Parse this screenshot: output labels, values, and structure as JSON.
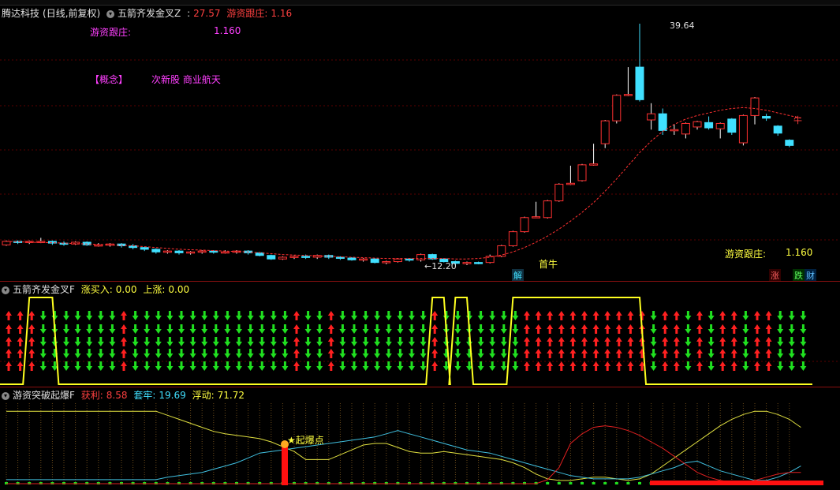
{
  "window": {
    "stock_name": "腾达科技",
    "mode": "(日线,前复权)"
  },
  "main_panel": {
    "indicator_name": "五箭齐发金叉Z",
    "price": "27.57",
    "label_youzi": "游资跟庄:",
    "value_youzi": "1.16",
    "overlay_label": "游资跟庄:",
    "overlay_value": "1.160",
    "concept_label": "【概念】",
    "concept_value": "次新股 商业航天",
    "bottom_label": "游资跟庄:",
    "bottom_value": "1.160",
    "high_label": "39.64",
    "low_label": "←12.20",
    "first_bull": "首牛",
    "tag_unlock": "解",
    "tag_bull": "牛",
    "tag_rise": "涨",
    "tag_fall": "跌",
    "tag_fin": "财",
    "colors": {
      "up": "#ff3030",
      "down": "#40e0ff",
      "ma": "#ff3030"
    }
  },
  "mid_panel": {
    "indicator_name": "五箭齐发金叉F",
    "label_buy": "涨买入:",
    "value_buy": "0.00",
    "label_rise": "上涨:",
    "value_rise": "0.00"
  },
  "bottom_panel": {
    "indicator_name": "游资突破起爆F",
    "label_profit": "获利:",
    "value_profit": "8.58",
    "label_trap": "套牢:",
    "value_trap": "19.69",
    "label_float": "浮动:",
    "value_float": "71.72",
    "explode_label": "★起爆点"
  },
  "chart_data": {
    "type": "candlestick",
    "price_range": [
      12.2,
      39.64
    ],
    "candles": [
      {
        "o": 14.5,
        "c": 14.9,
        "h": 15.0,
        "l": 14.4
      },
      {
        "o": 14.9,
        "c": 14.8,
        "h": 15.0,
        "l": 14.6
      },
      {
        "o": 14.8,
        "c": 14.9,
        "h": 15.0,
        "l": 14.6
      },
      {
        "o": 14.9,
        "c": 14.9,
        "h": 15.3,
        "l": 14.7
      },
      {
        "o": 14.9,
        "c": 14.7,
        "h": 15.0,
        "l": 14.5
      },
      {
        "o": 14.7,
        "c": 14.6,
        "h": 14.9,
        "l": 14.4
      },
      {
        "o": 14.6,
        "c": 14.8,
        "h": 14.9,
        "l": 14.5
      },
      {
        "o": 14.8,
        "c": 14.5,
        "h": 14.9,
        "l": 14.4
      },
      {
        "o": 14.5,
        "c": 14.5,
        "h": 14.7,
        "l": 14.3
      },
      {
        "o": 14.5,
        "c": 14.6,
        "h": 14.7,
        "l": 14.3
      },
      {
        "o": 14.6,
        "c": 14.4,
        "h": 14.7,
        "l": 14.2
      },
      {
        "o": 14.4,
        "c": 14.2,
        "h": 14.6,
        "l": 14.0
      },
      {
        "o": 14.2,
        "c": 14.0,
        "h": 14.3,
        "l": 13.8
      },
      {
        "o": 14.0,
        "c": 13.7,
        "h": 14.1,
        "l": 13.5
      },
      {
        "o": 13.7,
        "c": 13.8,
        "h": 13.9,
        "l": 13.5
      },
      {
        "o": 13.8,
        "c": 13.6,
        "h": 13.9,
        "l": 13.4
      },
      {
        "o": 13.6,
        "c": 13.7,
        "h": 13.8,
        "l": 13.4
      },
      {
        "o": 13.7,
        "c": 13.8,
        "h": 13.9,
        "l": 13.5
      },
      {
        "o": 13.8,
        "c": 13.7,
        "h": 13.9,
        "l": 13.5
      },
      {
        "o": 13.7,
        "c": 13.7,
        "h": 13.9,
        "l": 13.5
      },
      {
        "o": 13.7,
        "c": 13.8,
        "h": 13.9,
        "l": 13.5
      },
      {
        "o": 13.8,
        "c": 13.6,
        "h": 13.9,
        "l": 13.4
      },
      {
        "o": 13.6,
        "c": 13.3,
        "h": 13.7,
        "l": 13.2
      },
      {
        "o": 13.3,
        "c": 12.9,
        "h": 13.4,
        "l": 12.8
      },
      {
        "o": 12.9,
        "c": 13.1,
        "h": 13.2,
        "l": 12.8
      },
      {
        "o": 13.1,
        "c": 13.2,
        "h": 13.3,
        "l": 12.9
      },
      {
        "o": 13.2,
        "c": 13.1,
        "h": 13.4,
        "l": 12.9
      },
      {
        "o": 13.1,
        "c": 13.3,
        "h": 13.4,
        "l": 12.9
      },
      {
        "o": 13.3,
        "c": 13.1,
        "h": 13.4,
        "l": 12.9
      },
      {
        "o": 13.1,
        "c": 13.0,
        "h": 13.2,
        "l": 12.8
      },
      {
        "o": 13.0,
        "c": 12.8,
        "h": 13.1,
        "l": 12.7
      },
      {
        "o": 12.8,
        "c": 12.9,
        "h": 13.0,
        "l": 12.6
      },
      {
        "o": 12.9,
        "c": 12.5,
        "h": 13.0,
        "l": 12.4
      },
      {
        "o": 12.5,
        "c": 12.6,
        "h": 12.7,
        "l": 12.3
      },
      {
        "o": 12.6,
        "c": 12.9,
        "h": 13.0,
        "l": 12.5
      },
      {
        "o": 12.9,
        "c": 12.8,
        "h": 13.0,
        "l": 12.6
      },
      {
        "o": 12.8,
        "c": 13.4,
        "h": 13.5,
        "l": 12.6
      },
      {
        "o": 13.4,
        "c": 12.9,
        "h": 13.5,
        "l": 12.8
      },
      {
        "o": 12.9,
        "c": 12.6,
        "h": 13.0,
        "l": 12.5
      },
      {
        "o": 12.6,
        "c": 12.4,
        "h": 12.7,
        "l": 12.2
      },
      {
        "o": 12.4,
        "c": 12.5,
        "h": 12.6,
        "l": 12.2
      },
      {
        "o": 12.5,
        "c": 12.4,
        "h": 12.6,
        "l": 12.3
      },
      {
        "o": 12.5,
        "c": 13.2,
        "h": 13.4,
        "l": 12.4
      },
      {
        "o": 13.2,
        "c": 14.4,
        "h": 14.5,
        "l": 13.1
      },
      {
        "o": 14.4,
        "c": 16.0,
        "h": 16.1,
        "l": 14.3
      },
      {
        "o": 16.0,
        "c": 17.6,
        "h": 17.7,
        "l": 15.9
      },
      {
        "o": 17.6,
        "c": 17.7,
        "h": 19.4,
        "l": 17.6
      },
      {
        "o": 17.6,
        "c": 19.5,
        "h": 19.6,
        "l": 17.5
      },
      {
        "o": 19.5,
        "c": 21.4,
        "h": 21.5,
        "l": 19.4
      },
      {
        "o": 21.4,
        "c": 21.5,
        "h": 23.5,
        "l": 21.3
      },
      {
        "o": 21.8,
        "c": 23.6,
        "h": 23.7,
        "l": 21.7
      },
      {
        "o": 23.6,
        "c": 23.7,
        "h": 26.0,
        "l": 23.5
      },
      {
        "o": 26.0,
        "c": 28.6,
        "h": 28.7,
        "l": 25.5
      },
      {
        "o": 28.6,
        "c": 31.5,
        "h": 31.6,
        "l": 28.3
      },
      {
        "o": 31.5,
        "c": 31.6,
        "h": 34.7,
        "l": 31.4
      },
      {
        "o": 34.7,
        "c": 31.0,
        "h": 39.64,
        "l": 30.8
      },
      {
        "o": 28.7,
        "c": 29.4,
        "h": 30.6,
        "l": 27.6
      },
      {
        "o": 29.4,
        "c": 27.5,
        "h": 30.0,
        "l": 27.0
      },
      {
        "o": 27.6,
        "c": 27.6,
        "h": 28.2,
        "l": 27.0
      },
      {
        "o": 27.1,
        "c": 28.3,
        "h": 28.4,
        "l": 26.6
      },
      {
        "o": 27.9,
        "c": 28.5,
        "h": 28.6,
        "l": 27.6
      },
      {
        "o": 28.4,
        "c": 27.8,
        "h": 29.1,
        "l": 27.6
      },
      {
        "o": 27.7,
        "c": 28.3,
        "h": 28.4,
        "l": 26.6
      },
      {
        "o": 28.8,
        "c": 27.3,
        "h": 28.9,
        "l": 27.0
      },
      {
        "o": 26.1,
        "c": 29.2,
        "h": 29.3,
        "l": 25.8
      },
      {
        "o": 29.2,
        "c": 31.2,
        "h": 31.3,
        "l": 28.2
      },
      {
        "o": 29.1,
        "c": 28.9,
        "h": 29.4,
        "l": 28.6
      },
      {
        "o": 28.0,
        "c": 27.2,
        "h": 28.1,
        "l": 26.9
      },
      {
        "o": 26.4,
        "c": 25.8,
        "h": 26.5,
        "l": 25.6
      }
    ],
    "ma_curve": [
      14.9,
      14.85,
      14.8,
      14.78,
      14.75,
      14.7,
      14.65,
      14.6,
      14.55,
      14.5,
      14.45,
      14.4,
      14.3,
      14.2,
      14.1,
      14.0,
      13.95,
      13.9,
      13.85,
      13.8,
      13.75,
      13.7,
      13.6,
      13.5,
      13.4,
      13.35,
      13.3,
      13.25,
      13.2,
      13.15,
      13.1,
      13.05,
      13.0,
      12.95,
      12.95,
      12.95,
      12.95,
      12.95,
      12.95,
      12.9,
      12.9,
      12.95,
      13.1,
      13.35,
      13.7,
      14.2,
      14.8,
      15.5,
      16.3,
      17.2,
      18.2,
      19.3,
      20.6,
      22.0,
      23.5,
      25.0,
      26.3,
      27.4,
      28.2,
      28.8,
      29.2,
      29.5,
      29.8,
      30.0,
      30.1,
      30.0,
      29.8,
      29.5,
      29.2,
      28.9
    ],
    "mid_signals": [
      "up",
      "up",
      "up",
      "down",
      "down",
      "down",
      "down",
      "down",
      "down",
      "down",
      "up",
      "down",
      "down",
      "down",
      "down",
      "down",
      "down",
      "down",
      "down",
      "down",
      "down",
      "down",
      "down",
      "down",
      "down",
      "up",
      "down",
      "down",
      "up",
      "down",
      "down",
      "down",
      "down",
      "down",
      "down",
      "down",
      "down",
      "up",
      "down",
      "down",
      "down",
      "down",
      "down",
      "down",
      "down",
      "up",
      "up",
      "up",
      "up",
      "up",
      "up",
      "up",
      "up",
      "up",
      "up",
      "up",
      "down",
      "up",
      "up",
      "down",
      "up",
      "down",
      "up",
      "up",
      "down",
      "up",
      "up",
      "down",
      "down",
      "down"
    ],
    "yellow_spikes": [
      {
        "from": 2,
        "to": 4
      },
      {
        "from": 37,
        "to": 38
      },
      {
        "from": 39,
        "to": 40
      },
      {
        "from": 44,
        "to": 55
      }
    ],
    "cycle_yellow": [
      90,
      90,
      90,
      90,
      90,
      90,
      90,
      90,
      90,
      90,
      90,
      90,
      90,
      90,
      85,
      80,
      75,
      70,
      65,
      62,
      60,
      58,
      56,
      52,
      46,
      40,
      30,
      30,
      30,
      36,
      42,
      48,
      50,
      50,
      45,
      40,
      38,
      38,
      40,
      38,
      36,
      34,
      32,
      30,
      26,
      20,
      12,
      6,
      4,
      4,
      6,
      8,
      8,
      6,
      4,
      6,
      12,
      22,
      32,
      42,
      52,
      62,
      72,
      80,
      86,
      90,
      90,
      86,
      80,
      70
    ],
    "cycle_cyan": [
      5,
      5,
      5,
      5,
      5,
      5,
      5,
      5,
      5,
      5,
      5,
      5,
      5,
      5,
      8,
      10,
      12,
      14,
      18,
      22,
      26,
      32,
      38,
      40,
      42,
      44,
      46,
      48,
      50,
      52,
      54,
      56,
      58,
      62,
      66,
      62,
      58,
      54,
      50,
      46,
      42,
      40,
      38,
      34,
      30,
      26,
      22,
      18,
      14,
      10,
      8,
      6,
      6,
      6,
      6,
      8,
      12,
      16,
      20,
      26,
      28,
      22,
      16,
      12,
      8,
      4,
      4,
      8,
      14,
      22
    ],
    "cycle_red": [
      0,
      0,
      0,
      0,
      0,
      0,
      0,
      0,
      0,
      0,
      0,
      0,
      0,
      0,
      0,
      0,
      0,
      0,
      0,
      0,
      0,
      0,
      0,
      0,
      0,
      0,
      0,
      0,
      0,
      0,
      0,
      0,
      0,
      0,
      0,
      0,
      0,
      0,
      0,
      0,
      0,
      0,
      0,
      0,
      0,
      0,
      0,
      5,
      20,
      50,
      62,
      70,
      72,
      70,
      66,
      60,
      52,
      44,
      34,
      24,
      14,
      8,
      4,
      2,
      2,
      4,
      8,
      12,
      14,
      14
    ]
  }
}
